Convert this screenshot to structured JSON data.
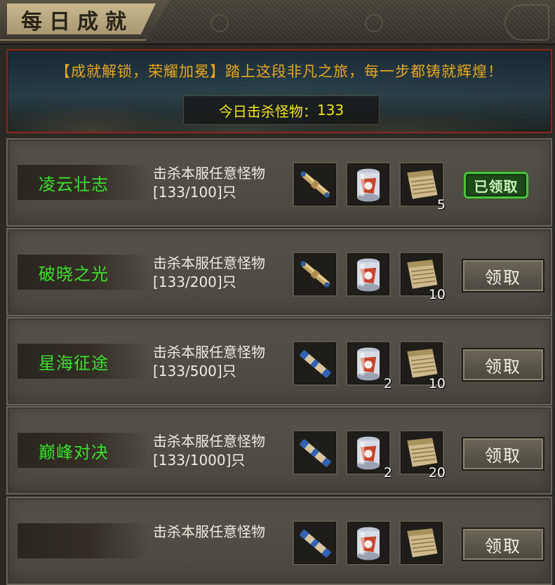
{
  "window": {
    "title": "每日成就"
  },
  "banner": {
    "message": "【成就解锁，荣耀加冕】踏上这段非凡之旅，每一步都铸就辉煌！",
    "kills_label": "今日击杀怪物：",
    "kills_value": "133"
  },
  "rows": [
    {
      "name": "凌云壮志",
      "desc_line1": "击杀本服任意怪物",
      "desc_line2": "[133/100]只",
      "rewards": [
        {
          "icon": "scroll-icon",
          "count": ""
        },
        {
          "icon": "jar-icon",
          "count": ""
        },
        {
          "icon": "parchment-icon",
          "count": "5"
        }
      ],
      "button_label": "已领取",
      "claimed": true
    },
    {
      "name": "破晓之光",
      "desc_line1": "击杀本服任意怪物",
      "desc_line2": "[133/200]只",
      "rewards": [
        {
          "icon": "scroll-icon",
          "count": ""
        },
        {
          "icon": "jar-icon",
          "count": ""
        },
        {
          "icon": "parchment-icon",
          "count": "10"
        }
      ],
      "button_label": "领取",
      "claimed": false
    },
    {
      "name": "星海征途",
      "desc_line1": "击杀本服任意怪物",
      "desc_line2": "[133/500]只",
      "rewards": [
        {
          "icon": "blue-scroll-icon",
          "count": ""
        },
        {
          "icon": "jar-icon",
          "count": "2"
        },
        {
          "icon": "parchment-icon",
          "count": "10"
        }
      ],
      "button_label": "领取",
      "claimed": false
    },
    {
      "name": "巅峰对决",
      "desc_line1": "击杀本服任意怪物",
      "desc_line2": "[133/1000]只",
      "rewards": [
        {
          "icon": "blue-scroll-icon",
          "count": ""
        },
        {
          "icon": "jar-icon",
          "count": "2"
        },
        {
          "icon": "parchment-icon",
          "count": "20"
        }
      ],
      "button_label": "领取",
      "claimed": false
    },
    {
      "name": "",
      "desc_line1": "击杀本服任意怪物",
      "desc_line2": "",
      "rewards": [
        {
          "icon": "blue-scroll-icon",
          "count": ""
        },
        {
          "icon": "jar-icon",
          "count": ""
        },
        {
          "icon": "parchment-icon",
          "count": ""
        }
      ],
      "button_label": "领取",
      "claimed": false
    }
  ]
}
